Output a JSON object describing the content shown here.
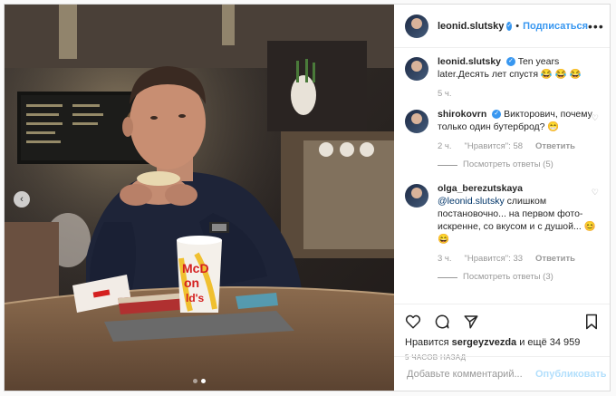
{
  "header": {
    "username": "leonid.slutsky",
    "separator": "•",
    "follow_label": "Подписаться",
    "more_icon": "more-dots-icon"
  },
  "caption": {
    "username": "leonid.slutsky",
    "text": "Ten years later.Десять лет спустя 😂 😂 😂",
    "time": "5 ч."
  },
  "comments": [
    {
      "username": "shirokovrn",
      "text": "Викторович, почему только один бутерброд? 😁",
      "time": "2 ч.",
      "likes": "\"Нравится\": 58",
      "reply": "Ответить",
      "views": "Посмотреть ответы (5)"
    },
    {
      "username": "olga_berezutskaya",
      "mention": "@leonid.slutsky",
      "text": "слишком постановочно... на первом фото-искренне, со вкусом и с душой... 😊 😄",
      "time": "3 ч.",
      "likes": "\"Нравится\": 33",
      "reply": "Ответить",
      "views": "Посмотреть ответы (3)"
    }
  ],
  "likes": {
    "prefix": "Нравится",
    "user": "sergeyzvezda",
    "suffix": "и ещё 34 959"
  },
  "timestamp": "5 ЧАСОВ НАЗАД",
  "add_comment": {
    "placeholder": "Добавьте комментарий...",
    "publish": "Опубликовать"
  },
  "photo": {
    "cup_text_1": "McD",
    "cup_text_2": "on",
    "cup_text_3": "ld's"
  }
}
